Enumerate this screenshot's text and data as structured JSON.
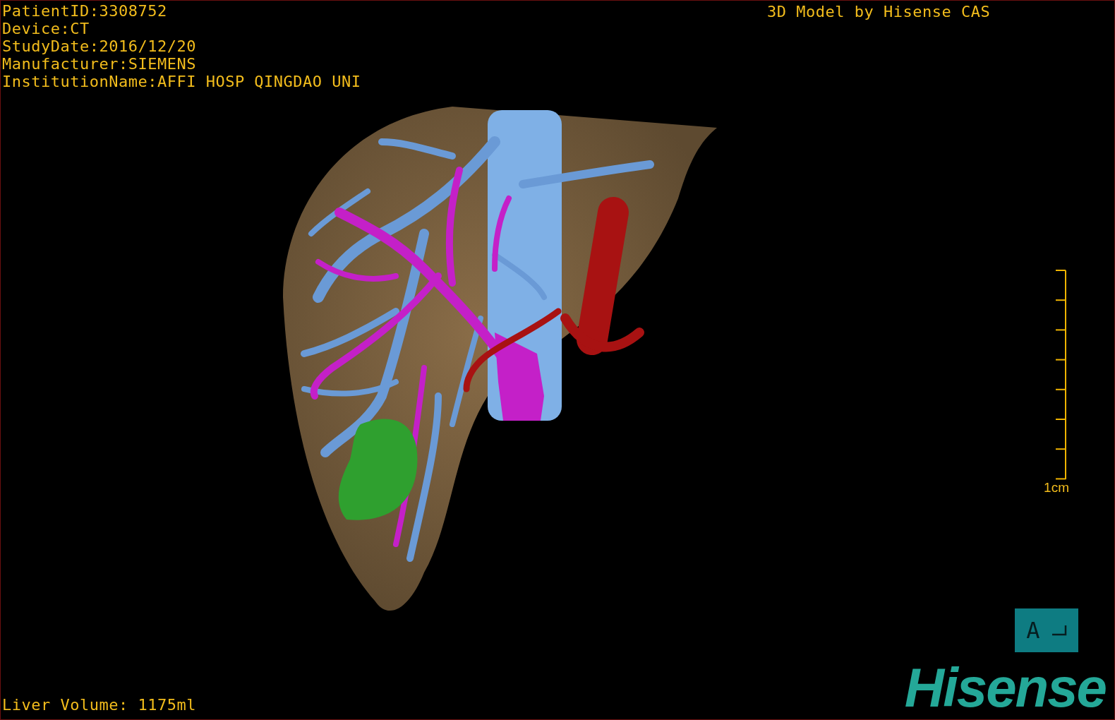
{
  "info_lines": [
    "PatientID:3308752",
    "Device:CT",
    "StudyDate:2016/12/20",
    "Manufacturer:SIEMENS",
    "InstitutionName:AFFI HOSP QINGDAO UNI"
  ],
  "title": "3D Model by Hisense CAS",
  "scale": {
    "label": "1cm"
  },
  "orientation": {
    "label": "A"
  },
  "logo": "Hisense",
  "liver_volume": "Liver Volume: 1175ml"
}
